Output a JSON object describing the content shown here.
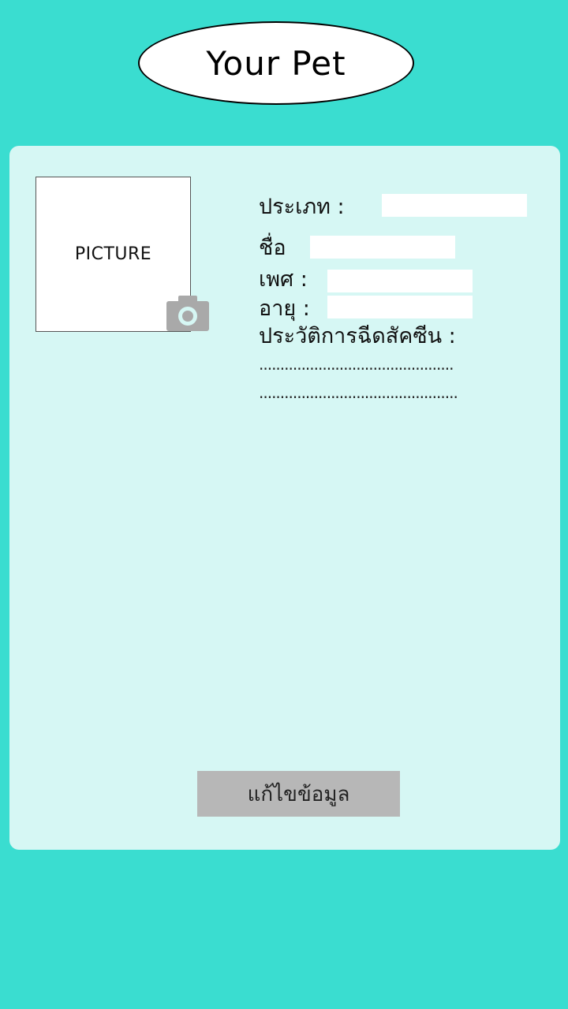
{
  "header": {
    "title": "Your Pet"
  },
  "picture": {
    "placeholder_text": "PICTURE",
    "camera_icon": "camera-icon"
  },
  "form": {
    "type_label": "ประเภท :",
    "type_value": "",
    "name_label": "ชื่อ",
    "name_value": "",
    "gender_label": "เพศ :",
    "gender_value": "",
    "age_label": "อายุ :",
    "age_value": "",
    "vaccine_label": "ประวัติการฉีดสัคซีน :",
    "vaccine_line1": "..............................................",
    "vaccine_line2": "..............................................."
  },
  "actions": {
    "edit_label": "แก้ไขข้อมูล"
  },
  "colors": {
    "background": "#3ADDD0",
    "card": "#D6F7F4",
    "button": "#B7B7B7",
    "field": "#FFFFFF"
  }
}
